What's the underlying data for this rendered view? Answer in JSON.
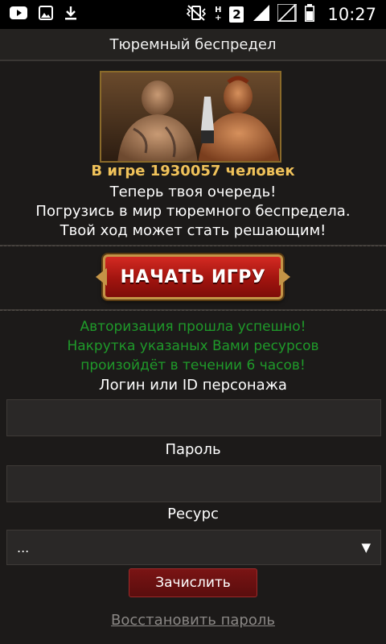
{
  "statusbar": {
    "time": "10:27",
    "sim_slot": "2",
    "net_type_top": "H",
    "net_type_bottom": "+",
    "icons": [
      "youtube-icon",
      "image-icon",
      "download-icon",
      "vibrate-icon",
      "signal-icon",
      "signal-icon",
      "battery-icon"
    ]
  },
  "header": {
    "title": "Тюремный беспредел"
  },
  "promo": {
    "online_text": "В игре 1930057 человек",
    "line1": "Теперь твоя очередь!",
    "line2": "Погрузись в мир тюремного беспредела.",
    "line3": "Твой ход может стать решающим!"
  },
  "start_button": {
    "label": "НАЧАТЬ ИГРУ"
  },
  "auth_message": {
    "line1": "Авторизация прошла успешно!",
    "line2": "Накрутка указаных Вами ресурсов",
    "line3": "произойдёт в течении 6 часов!"
  },
  "form": {
    "login_label": "Логин или ID персонажа",
    "login_value": "",
    "password_label": "Пароль",
    "password_value": "",
    "resource_label": "Ресурс",
    "resource_selected": "...",
    "submit_label": "Зачислить",
    "restore_link": "Восстановить пароль"
  },
  "colors": {
    "background": "#1c1a19",
    "online_text": "#f0c25a",
    "auth_message": "#1f9a2a",
    "start_button": "#b31a14",
    "submit_button": "#6a1010"
  }
}
